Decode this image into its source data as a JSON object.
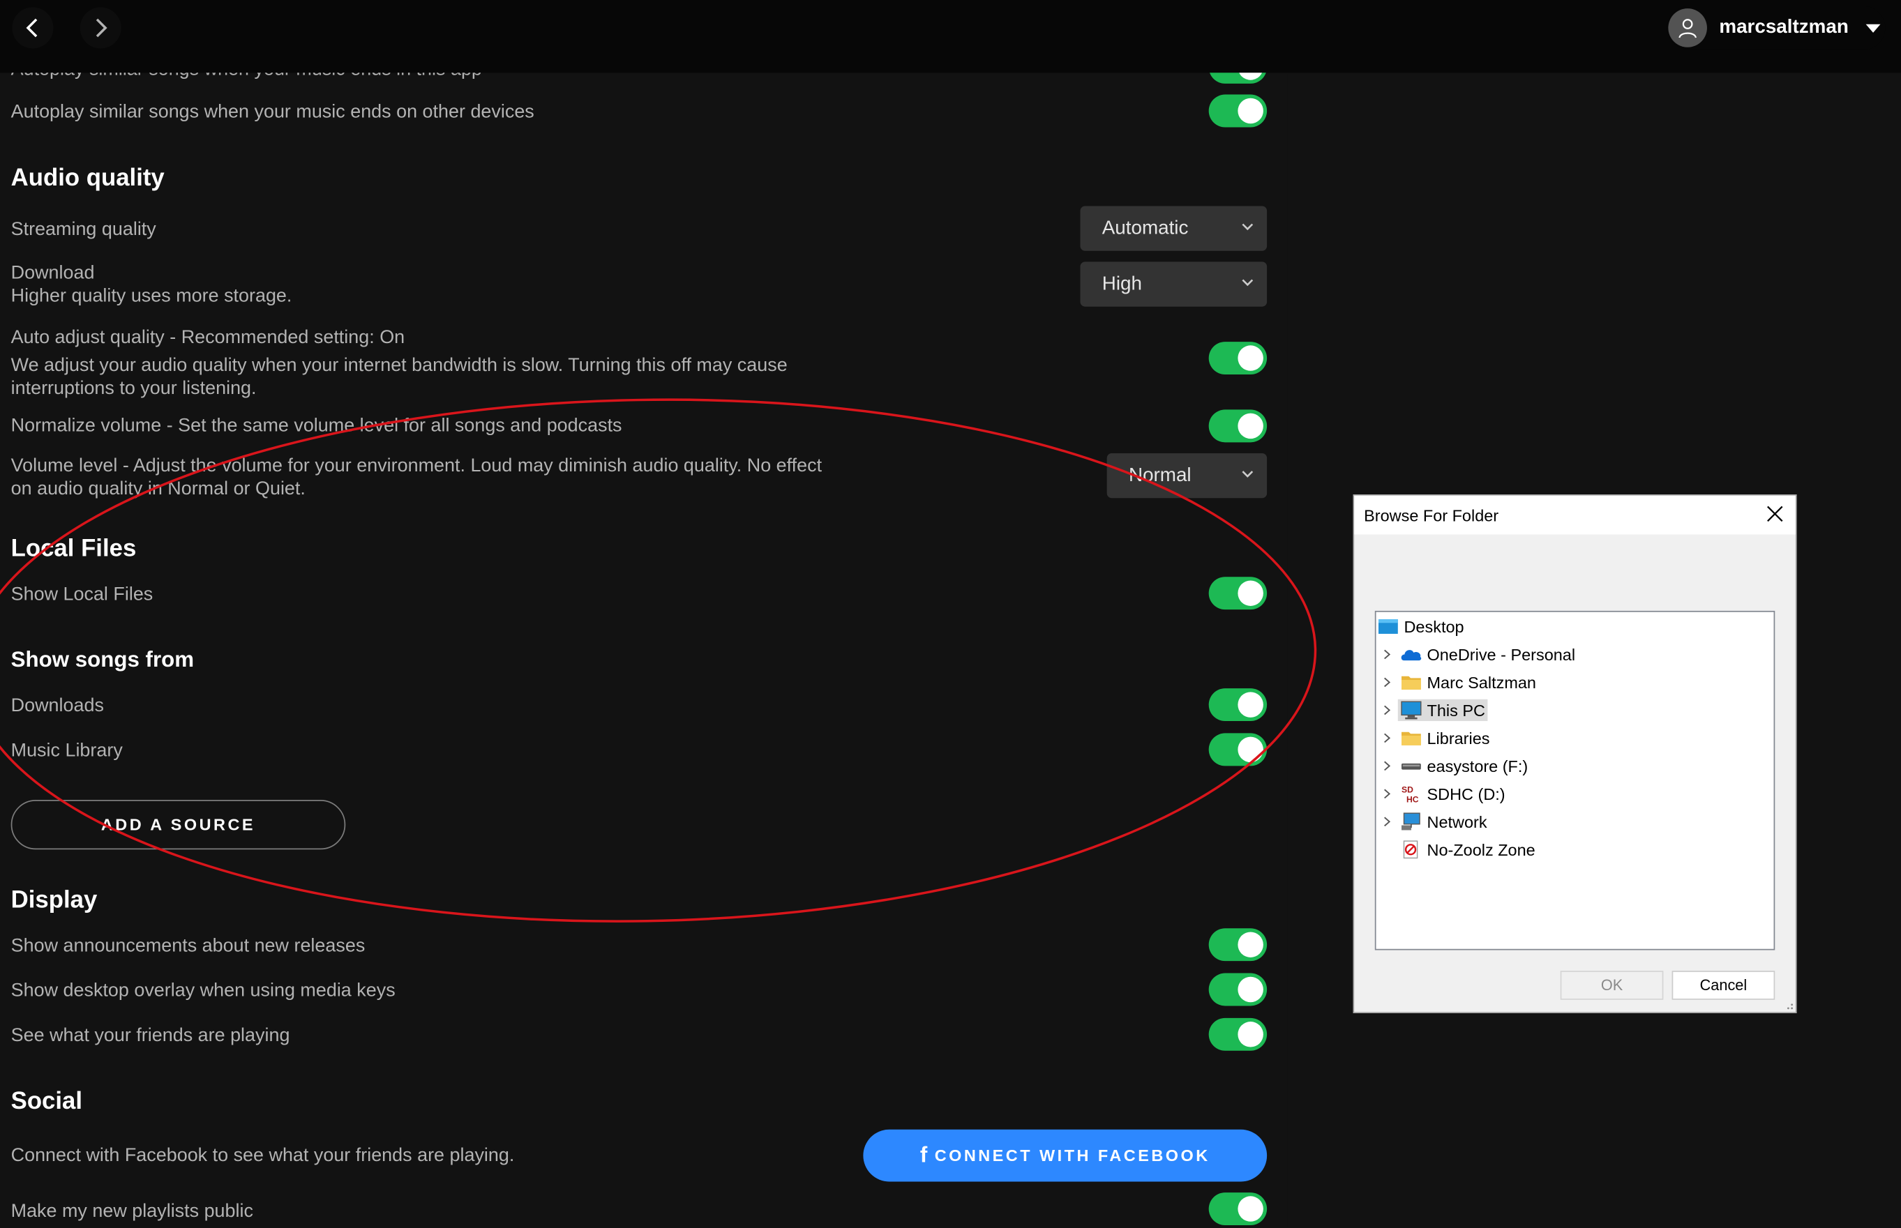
{
  "user": {
    "name": "marcsaltzman"
  },
  "autoplay": {
    "same_device_label": "Autoplay similar songs when your music ends in this app",
    "other_devices_label": "Autoplay similar songs when your music ends on other devices"
  },
  "audio_quality": {
    "heading": "Audio quality",
    "streaming_label": "Streaming quality",
    "streaming_value": "Automatic",
    "download_label": "Download",
    "download_sub": "Higher quality uses more storage.",
    "download_value": "High",
    "auto_adjust_label": "Auto adjust quality - Recommended setting: On",
    "auto_adjust_desc": "We adjust your audio quality when your internet bandwidth is slow. Turning this off may cause interruptions to your listening.",
    "normalize_label": "Normalize volume - Set the same volume level for all songs and podcasts",
    "volume_level_label": "Volume level - Adjust the volume for your environment. Loud may diminish audio quality. No effect on audio quality in Normal or Quiet.",
    "volume_level_value": "Normal"
  },
  "local_files": {
    "heading": "Local Files",
    "show_label": "Show Local Files"
  },
  "show_songs_from": {
    "heading": "Show songs from",
    "downloads_label": "Downloads",
    "music_library_label": "Music Library",
    "add_source_label": "ADD A SOURCE"
  },
  "display": {
    "heading": "Display",
    "announcements_label": "Show announcements about new releases",
    "overlay_label": "Show desktop overlay when using media keys",
    "friends_label": "See what your friends are playing"
  },
  "social": {
    "heading": "Social",
    "facebook_desc": "Connect with Facebook to see what your friends are playing.",
    "facebook_button": "CONNECT WITH FACEBOOK",
    "public_playlists_label": "Make my new playlists public"
  },
  "colors": {
    "toggle_on": "#1db954",
    "facebook_blue": "#2d88ff",
    "annotation_red": "#d9151b"
  },
  "dialog": {
    "title": "Browse For Folder",
    "tree": [
      {
        "label": "Desktop",
        "icon": "desktop-icon"
      },
      {
        "label": "OneDrive - Personal",
        "icon": "cloud-icon"
      },
      {
        "label": "Marc Saltzman",
        "icon": "folder-icon"
      },
      {
        "label": "This PC",
        "icon": "monitor-icon",
        "selected": true
      },
      {
        "label": "Libraries",
        "icon": "folder-icon"
      },
      {
        "label": "easystore (F:)",
        "icon": "drive-icon"
      },
      {
        "label": "SDHC (D:)",
        "icon": "sd-card-icon"
      },
      {
        "label": "Network",
        "icon": "network-icon"
      },
      {
        "label": "No-Zoolz Zone",
        "icon": "zoolz-icon"
      }
    ],
    "ok_label": "OK",
    "cancel_label": "Cancel"
  }
}
